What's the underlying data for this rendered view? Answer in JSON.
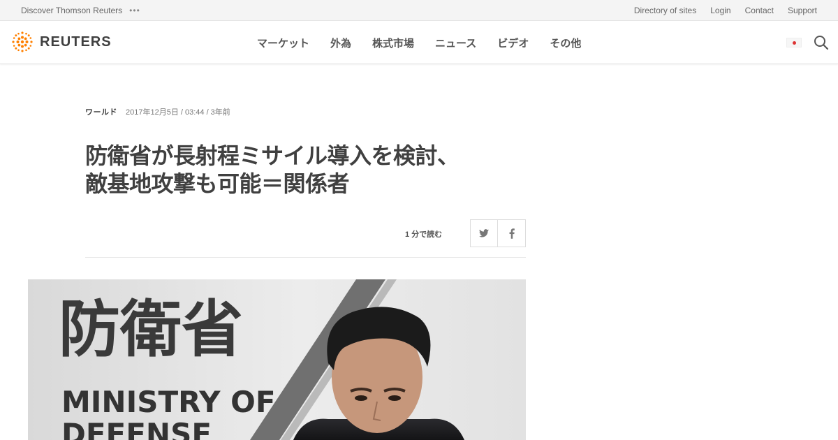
{
  "utility": {
    "discover": "Discover Thomson Reuters",
    "links": [
      "Directory of sites",
      "Login",
      "Contact",
      "Support"
    ]
  },
  "brand": {
    "name": "REUTERS",
    "accent": "#ff8000"
  },
  "nav": {
    "items": [
      "マーケット",
      "外為",
      "株式市場",
      "ニュース",
      "ビデオ",
      "その他"
    ]
  },
  "article": {
    "section": "ワールド",
    "date": "2017年12月5日 / 03:44 / 3年前",
    "headline_line1": "防衛省が長射程ミサイル導入を検討、",
    "headline_line2": "敵基地攻撃も可能＝関係者",
    "read_time": "1 分で読む"
  },
  "photo": {
    "sign_kanji": "防衛省",
    "sign_line1": "MINISTRY OF",
    "sign_line2": "DEFENSE"
  },
  "icons": {
    "more": "more-dots-icon",
    "flag": "japan-flag-icon",
    "search": "search-icon",
    "twitter": "twitter-icon",
    "facebook": "facebook-icon"
  }
}
